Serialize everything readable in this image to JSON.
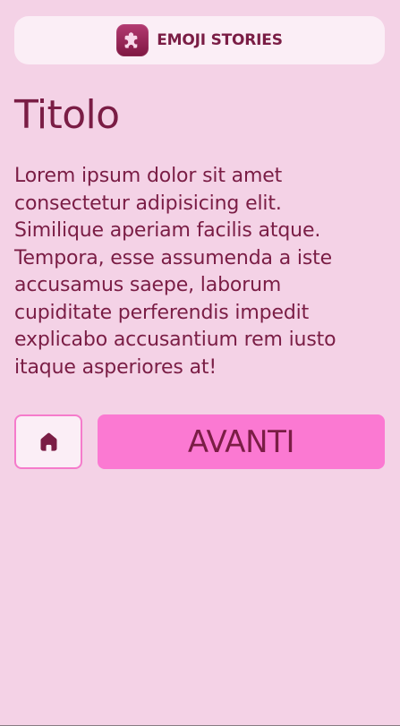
{
  "header": {
    "brand": "EMOJI STORIES",
    "logo_icon": "puzzle-piece-icon"
  },
  "content": {
    "title": "Titolo",
    "body": "Lorem ipsum dolor sit amet consectetur adipisicing elit. Similique aperiam facilis atque. Tempora, esse assumenda a iste accusamus saepe, laborum cupiditate perferendis impedit explicabo accusantium rem iusto itaque asperiores at!"
  },
  "actions": {
    "home_icon": "home-icon",
    "next_label": "AVANTI"
  },
  "colors": {
    "background": "#f4d2e6",
    "surface": "#fbeef6",
    "accent": "#fb79d2",
    "accent_border": "#f57bcb",
    "text": "#7a1d45",
    "logo_gradient_top": "#b33b72",
    "logo_gradient_bottom": "#7f1742"
  }
}
